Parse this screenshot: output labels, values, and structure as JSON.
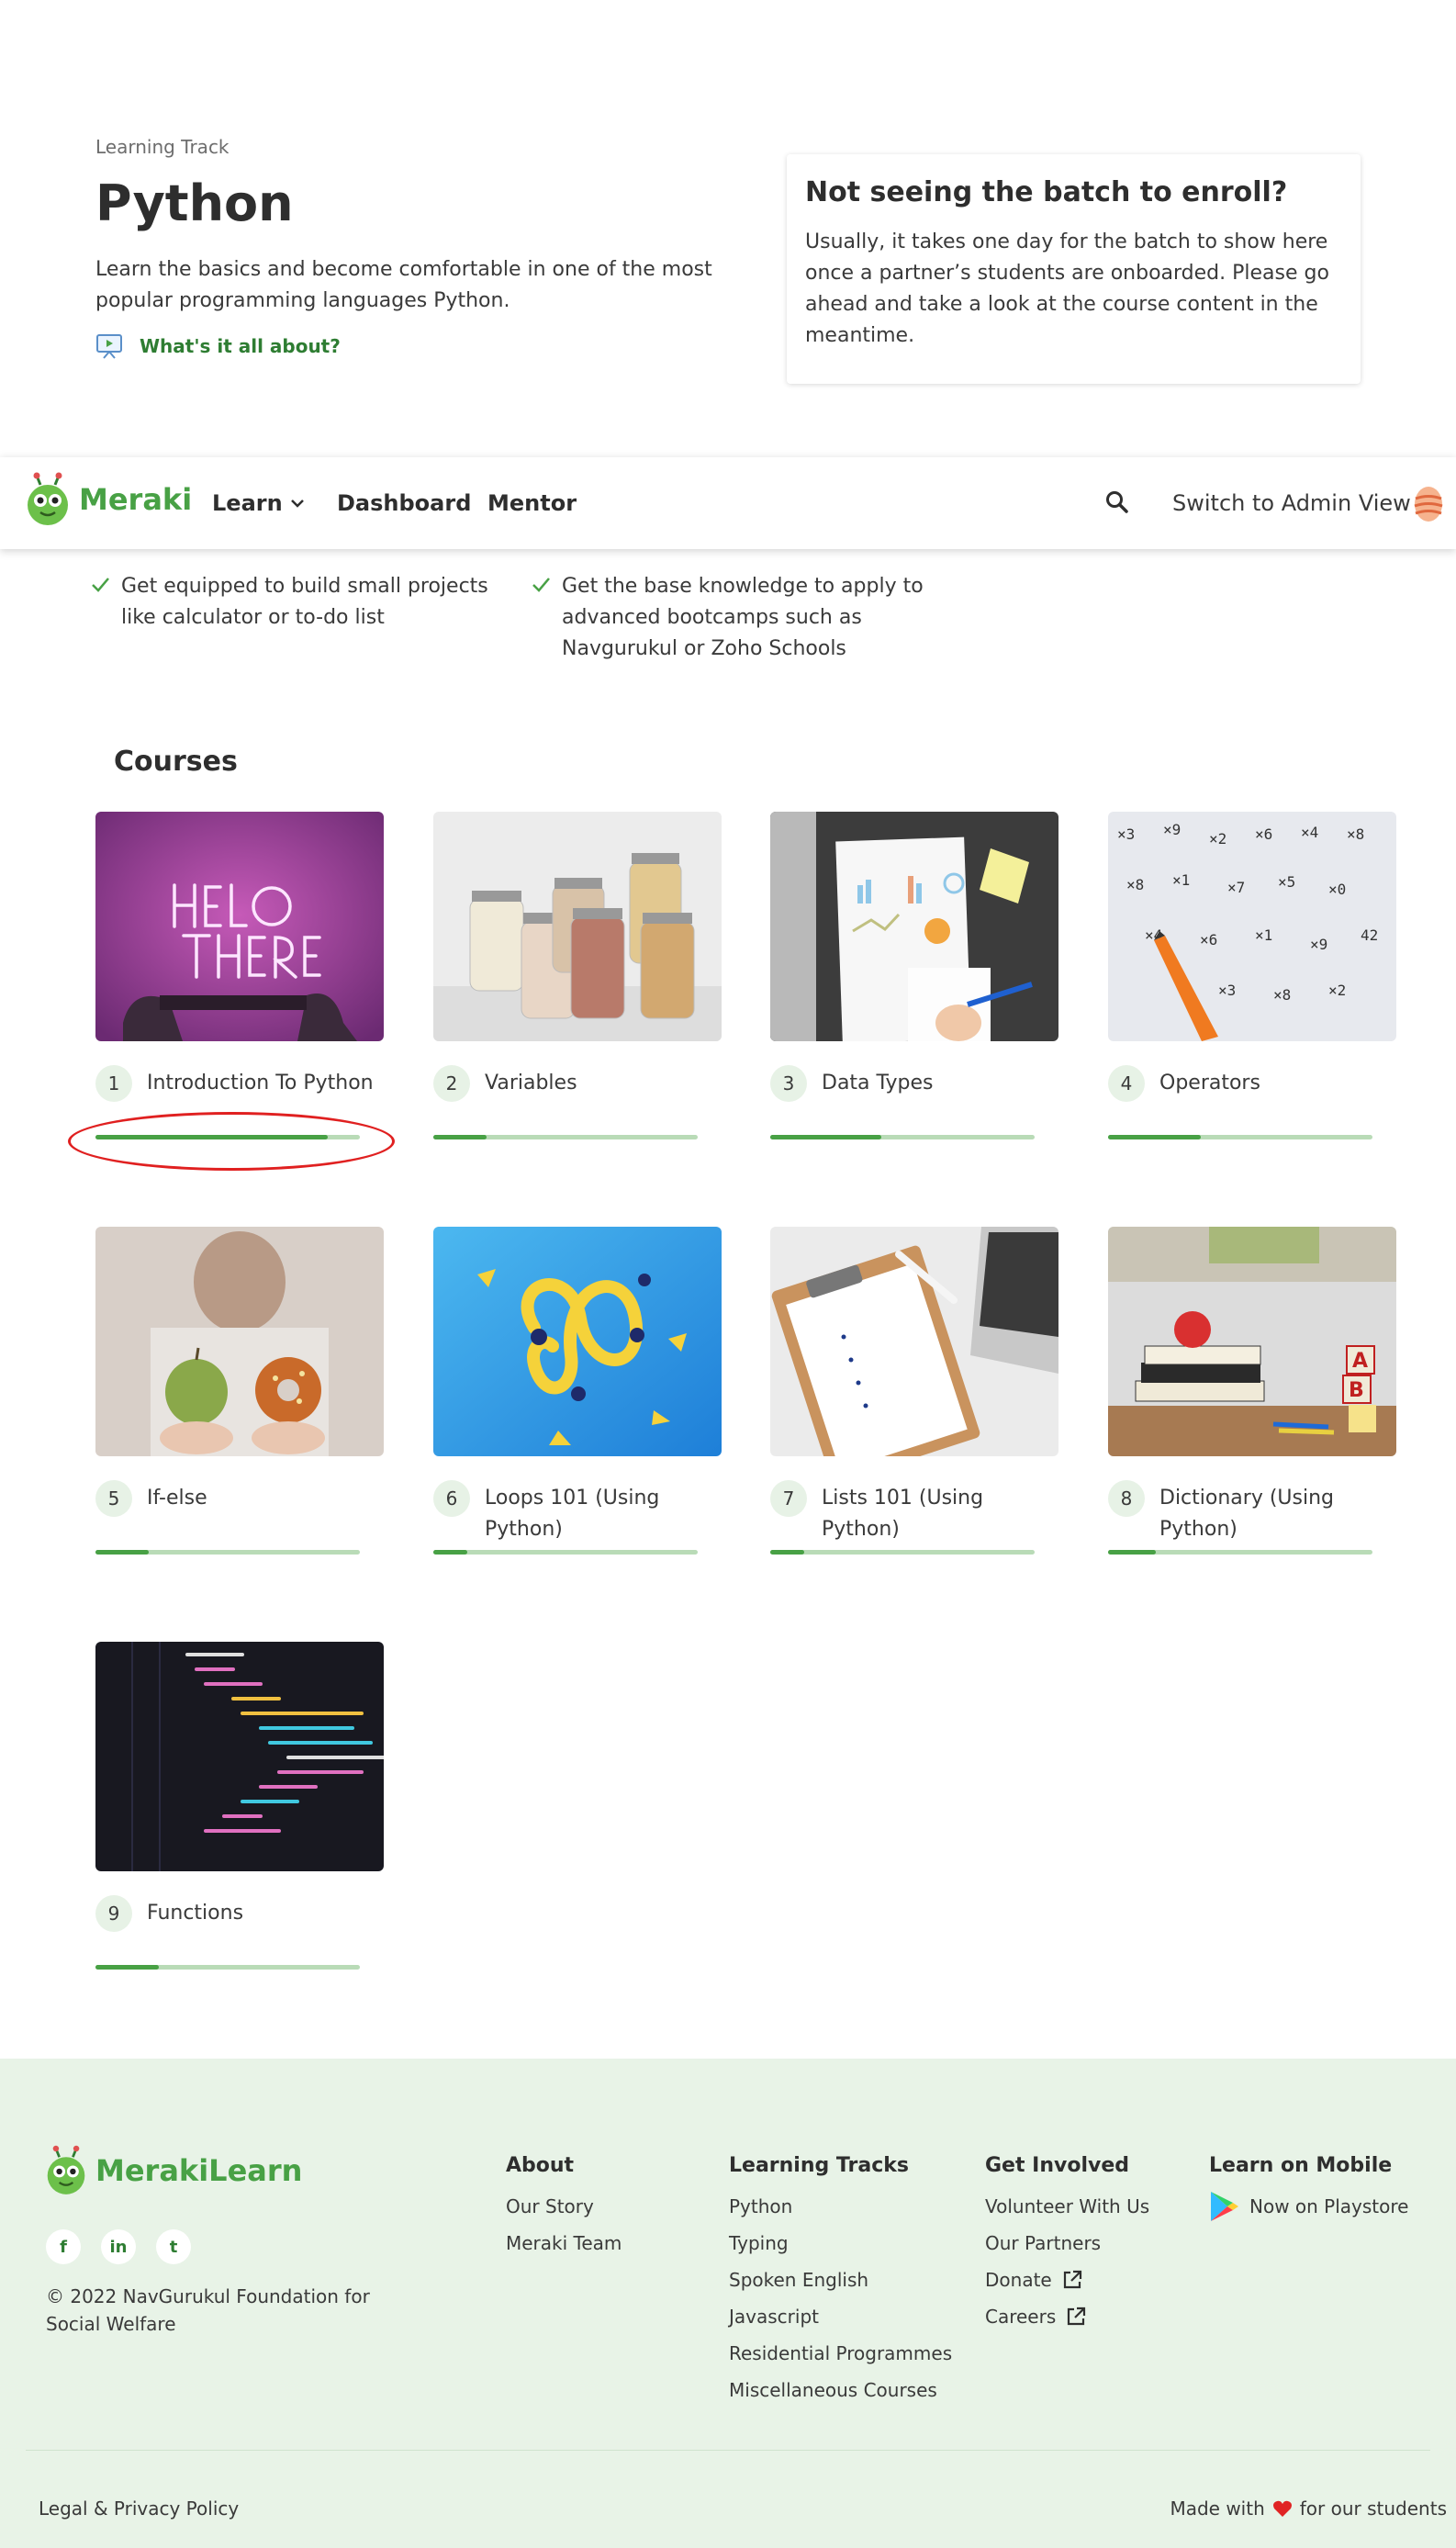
{
  "hero": {
    "eyebrow": "Learning Track",
    "title": "Python",
    "description": "Learn the basics and become comfortable in one of the most popular programming languages Python.",
    "video_link": "What's it all about?"
  },
  "notice": {
    "title": "Not seeing the batch to enroll?",
    "body": "Usually, it takes one day for the batch to show here once a partner’s students are onboarded. Please go ahead and take a look at the course content in the meantime."
  },
  "navbar": {
    "logo_text": "Meraki",
    "learn": "Learn",
    "dashboard": "Dashboard",
    "mentor": "Mentor",
    "switch_view": "Switch to Admin View"
  },
  "outcomes": [
    "Get equipped to build small projects like calculator or to-do list",
    "Get the base knowledge to apply to advanced bootcamps such as Navgurukul or Zoho Schools"
  ],
  "courses_heading": "Courses",
  "courses": [
    {
      "num": "1",
      "name": "Introduction To Python",
      "image": "hello-there-neon",
      "progress": 0.88
    },
    {
      "num": "2",
      "name": "Variables",
      "image": "jars",
      "progress": 0.2
    },
    {
      "num": "3",
      "name": "Data Types",
      "image": "charts-desk",
      "progress": 0.42
    },
    {
      "num": "4",
      "name": "Operators",
      "image": "math-sheet",
      "progress": 0.35
    },
    {
      "num": "5",
      "name": "If-else",
      "image": "apple-donut",
      "progress": 0.2
    },
    {
      "num": "6",
      "name": "Loops 101 (Using Python)",
      "image": "lemon-peel",
      "progress": 0.13
    },
    {
      "num": "7",
      "name": "Lists 101 (Using Python)",
      "image": "clipboard-laptop",
      "progress": 0.13
    },
    {
      "num": "8",
      "name": "Dictionary (Using Python)",
      "image": "books-apple",
      "progress": 0.18
    },
    {
      "num": "9",
      "name": "Functions",
      "image": "code-screen",
      "progress": 0.24
    }
  ],
  "footer": {
    "logo_text": "MerakiLearn",
    "copyright": "© 2022 NavGurukul Foundation for Social Welfare",
    "socials": [
      "f",
      "in",
      "t"
    ],
    "columns": [
      {
        "title": "About",
        "links": [
          "Our Story",
          "Meraki Team"
        ]
      },
      {
        "title": "Learning Tracks",
        "links": [
          "Python",
          "Typing",
          "Spoken English",
          "Javascript",
          "Residential Programmes",
          "Miscellaneous Courses"
        ]
      },
      {
        "title": "Get Involved",
        "links": [
          "Volunteer With Us",
          "Our Partners",
          "Donate",
          "Careers"
        ]
      },
      {
        "title": "Learn on Mobile",
        "links": [
          "Now on Playstore"
        ]
      }
    ],
    "legal": "Legal & Privacy Policy",
    "made_with_prefix": "Made with",
    "made_with_suffix": "for our students"
  },
  "colors": {
    "brand_green": "#48a145",
    "link_green": "#2e7d32",
    "highlight_red": "#e02020",
    "footer_bg": "#e8f3e7"
  }
}
